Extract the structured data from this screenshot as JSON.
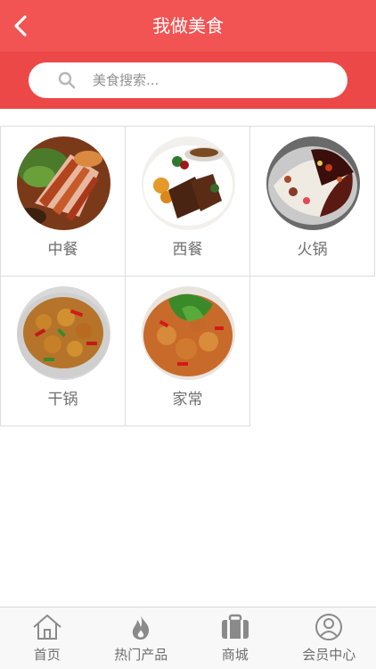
{
  "header": {
    "title": "我做美食",
    "back_icon": "chevron-left-icon"
  },
  "search": {
    "placeholder": "美食搜索...",
    "value": "",
    "icon": "search-icon"
  },
  "categories": [
    {
      "label": "中餐",
      "image": "roast-pork-dish-photo"
    },
    {
      "label": "西餐",
      "image": "steak-plate-photo"
    },
    {
      "label": "火锅",
      "image": "yin-yang-hotpot-photo"
    },
    {
      "label": "干锅",
      "image": "dry-pot-chicken-photo"
    },
    {
      "label": "家常",
      "image": "home-style-chicken-photo"
    }
  ],
  "tabbar": {
    "items": [
      {
        "label": "首页",
        "icon": "home-icon"
      },
      {
        "label": "热门产品",
        "icon": "flame-icon"
      },
      {
        "label": "商城",
        "icon": "briefcase-icon"
      },
      {
        "label": "会员中心",
        "icon": "user-circle-icon"
      }
    ]
  },
  "colors": {
    "header": "#f25353",
    "search_band": "#ec4848",
    "label_text": "#6e6e6e",
    "grid_border": "#dedede"
  }
}
